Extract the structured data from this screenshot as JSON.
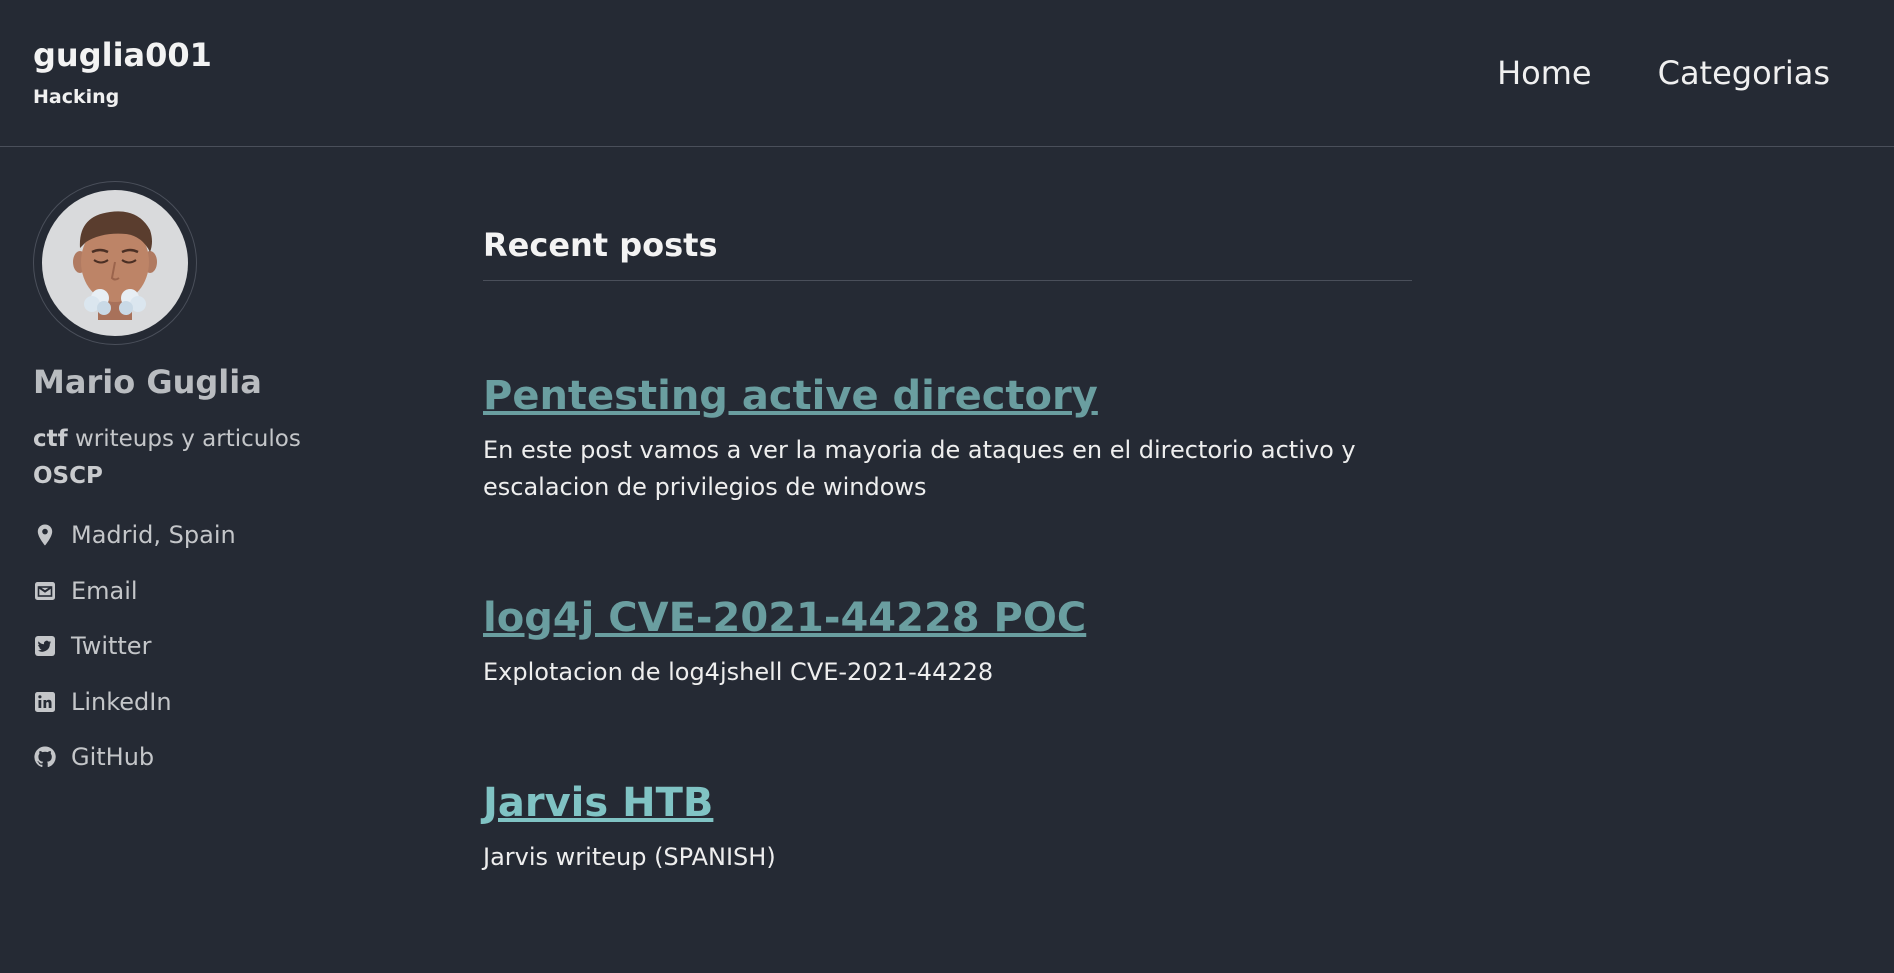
{
  "site": {
    "title": "guglia001",
    "subtitle": "Hacking"
  },
  "nav": {
    "items": [
      "Home",
      "Categorias"
    ]
  },
  "author": {
    "name": "Mario Guglia",
    "bio_bold": "ctf",
    "bio_rest": " writeups y articulos",
    "bio_line2": "OSCP",
    "links": [
      {
        "label": "Madrid, Spain",
        "icon": "map-marker-icon"
      },
      {
        "label": "Email",
        "icon": "envelope-icon"
      },
      {
        "label": "Twitter",
        "icon": "twitter-icon"
      },
      {
        "label": "LinkedIn",
        "icon": "linkedin-icon"
      },
      {
        "label": "GitHub",
        "icon": "github-icon"
      }
    ]
  },
  "main": {
    "section_title": "Recent posts",
    "posts": [
      {
        "title": "Pentesting active directory",
        "excerpt": "En este post vamos a ver la mayoria de ataques en el directorio activo y escalacion de privilegios de windows"
      },
      {
        "title": "log4j CVE-2021-44228 POC",
        "excerpt": "Explotacion de log4jshell CVE-2021-44228"
      },
      {
        "title": "Jarvis HTB",
        "excerpt": "Jarvis writeup (SPANISH)"
      }
    ]
  },
  "colors": {
    "background": "#252a34",
    "link": "#6a9ea0",
    "link_active": "#80c3c4"
  }
}
